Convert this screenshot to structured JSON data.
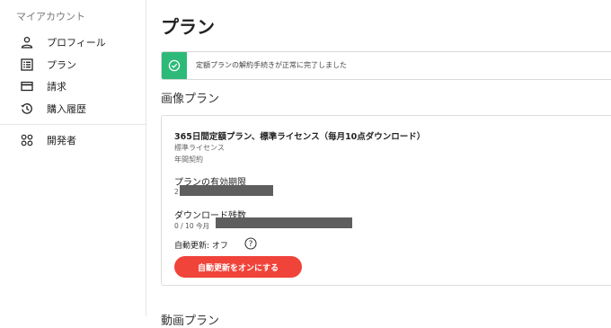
{
  "sidebar": {
    "heading": "マイアカウント",
    "items": [
      {
        "label": "プロフィール",
        "icon": "person-icon"
      },
      {
        "label": "プラン",
        "icon": "list-icon"
      },
      {
        "label": "請求",
        "icon": "card-icon"
      },
      {
        "label": "購入履歴",
        "icon": "history-icon"
      }
    ],
    "extra_items": [
      {
        "label": "開発者",
        "icon": "apps-icon"
      }
    ]
  },
  "main": {
    "page_title": "プラン",
    "banner": {
      "message": "定額プランの解約手続きが正常に完了しました",
      "icon": "check-circle-icon",
      "color": "#2dba78"
    },
    "section_title": "画像プラン",
    "plan": {
      "name": "365日間定額プラン、標準ライセンス（毎月10点ダウンロード）",
      "license": "標準ライセンス",
      "billing": "年間契約",
      "expiry_label": "プランの有効期限",
      "expiry_value": "2",
      "downloads_label": "ダウンロード残数",
      "downloads_value": "0 / 10 今月",
      "auto_renew": "自動更新: オフ",
      "enable_button": "自動更新をオンにする",
      "button_color": "#f0433a"
    },
    "next_section_title": "動画プラン"
  }
}
